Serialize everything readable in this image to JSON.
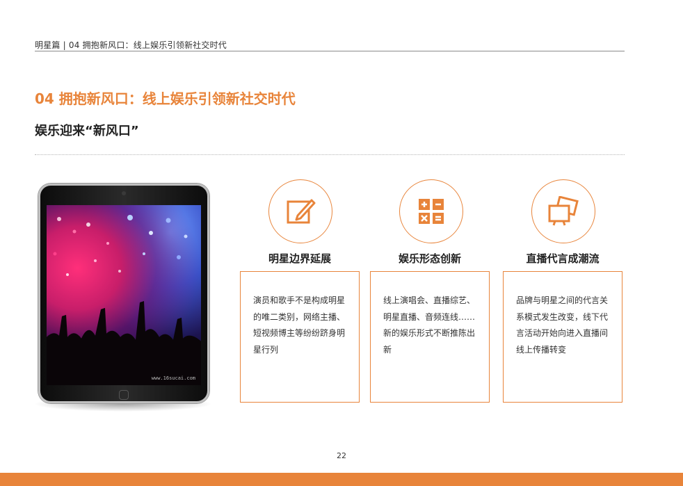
{
  "header": {
    "text": "明星篇 | 04  拥抱新风口：线上娱乐引领新社交时代"
  },
  "section": {
    "title": "04  拥抱新风口：线上娱乐引领新社交时代",
    "subtitle": "娱乐迎来“新风口”"
  },
  "tablet": {
    "watermark": "www.16sucai.com"
  },
  "features": [
    {
      "icon": "pencil-edit-icon",
      "title": "明星边界延展",
      "text": "演员和歌手不是构成明星的唯二类别，网络主播、短视频博主等纷纷跻身明星行列"
    },
    {
      "icon": "calculator-icon",
      "title": "娱乐形态创新",
      "text": "线上演唱会、直播综艺、明星直播、音频连线……新的娱乐形式不断推陈出新"
    },
    {
      "icon": "screens-icon",
      "title": "直播代言成潮流",
      "text": "品牌与明星之间的代言关系模式发生改变，线下代言活动开始向进入直播间线上传播转变"
    }
  ],
  "page": {
    "number": "22"
  },
  "colors": {
    "accent": "#e8843a",
    "text": "#222222",
    "divider": "#8a8a8a"
  }
}
